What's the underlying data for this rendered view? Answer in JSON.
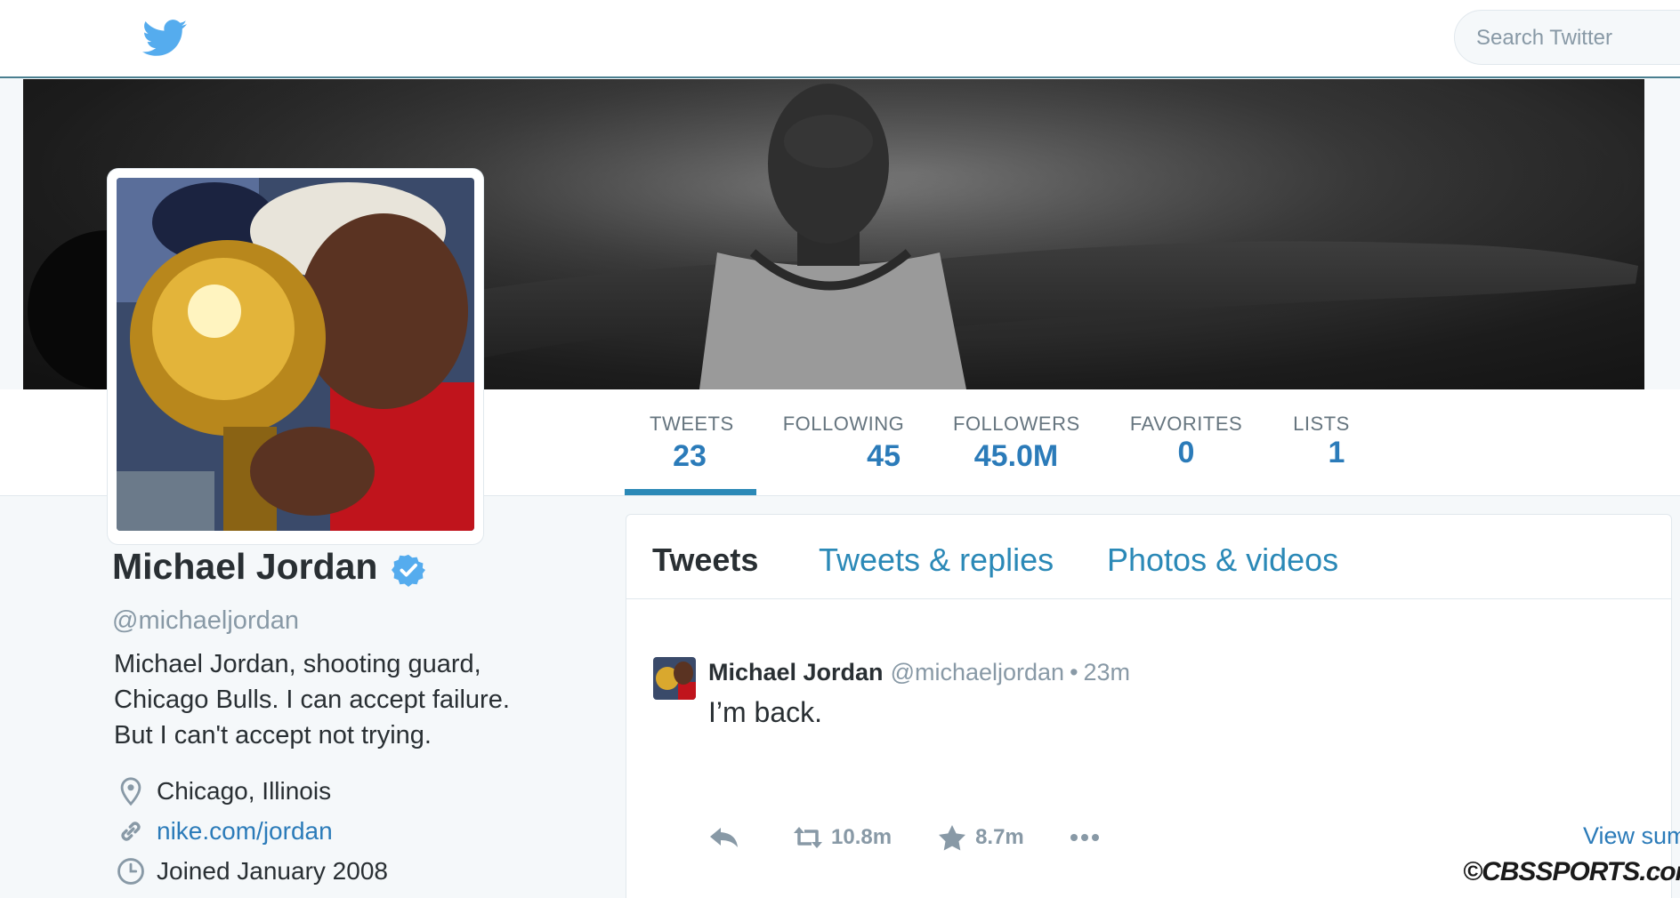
{
  "header": {
    "search_placeholder": "Search Twitter",
    "logo_icon": "twitter-bird-icon"
  },
  "stats": [
    {
      "label": "TWEETS",
      "value": "23",
      "active": true
    },
    {
      "label": "FOLLOWING",
      "value": "45",
      "active": false
    },
    {
      "label": "FOLLOWERS",
      "value": "45.0M",
      "active": false
    },
    {
      "label": "FAVORITES",
      "value": "0",
      "active": false
    },
    {
      "label": "LISTS",
      "value": "1",
      "active": false
    }
  ],
  "profile": {
    "name": "Michael Jordan",
    "handle": "@michaeljordan",
    "bio_lines": [
      "Michael Jordan, shooting guard,",
      "Chicago Bulls. I can accept failure.",
      "But I can't accept not trying."
    ],
    "location": "Chicago, Illinois",
    "website": "nike.com/jordan",
    "joined": "Joined January 2008"
  },
  "timeline": {
    "tabs": [
      "Tweets",
      "Tweets & replies",
      "Photos & videos"
    ],
    "active_tab": "Tweets"
  },
  "tweet": {
    "author": "Michael Jordan",
    "handle": "@michaeljordan",
    "separator": "•",
    "time": "23m",
    "text": "I’m back.",
    "retweets": "10.8m",
    "favorites": "8.7m",
    "view_summary": "View summary"
  },
  "watermark": "©CBSSPORTS.com",
  "colors": {
    "accent": "#2b7bb9",
    "twitter_blue": "#55acee",
    "muted": "#8899a6",
    "text": "#292f33"
  }
}
